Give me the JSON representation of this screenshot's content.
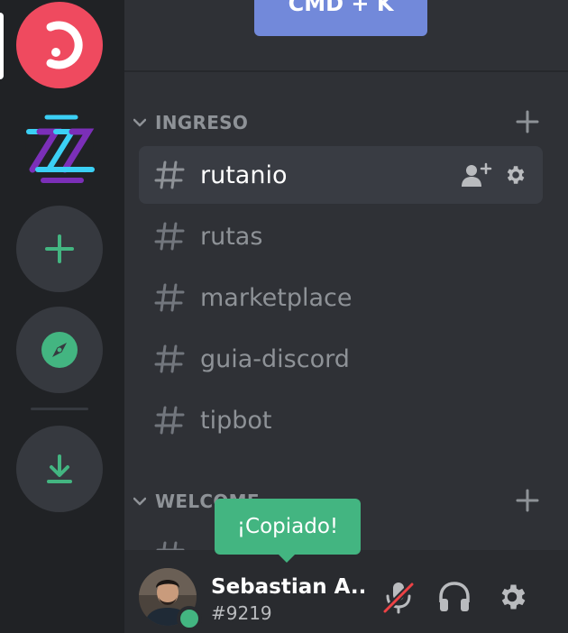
{
  "toolbar": {
    "command_label": "CMD + K"
  },
  "servers": [
    {
      "name": "red-server"
    },
    {
      "name": "logo-server"
    }
  ],
  "categories": [
    {
      "label": "INGRESO"
    },
    {
      "label": "WELCOME"
    }
  ],
  "channels": [
    {
      "name": "rutanio",
      "active": true
    },
    {
      "name": "rutas"
    },
    {
      "name": "marketplace"
    },
    {
      "name": "guia-discord"
    },
    {
      "name": "tipbot"
    }
  ],
  "tooltip": {
    "text": "¡Copiado!"
  },
  "user": {
    "name": "Sebastian A...",
    "tag": "#9219",
    "status": "online"
  },
  "colors": {
    "accent": "#7289da",
    "green": "#43b581",
    "red_server": "#ef4a5f",
    "mute_red": "#ed4245"
  }
}
